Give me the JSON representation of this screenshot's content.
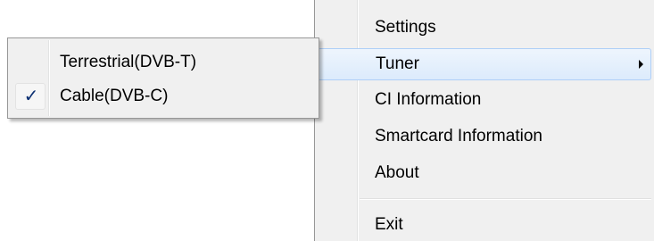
{
  "main_menu": {
    "items": [
      {
        "label": "Settings"
      },
      {
        "label": "Tuner",
        "has_submenu": true,
        "highlighted": true
      },
      {
        "label": "CI Information"
      },
      {
        "label": "Smartcard Information"
      },
      {
        "label": "About"
      },
      {
        "label": "Exit"
      }
    ],
    "arrow_icon": "submenu-arrow-icon"
  },
  "tuner_submenu": {
    "items": [
      {
        "label": "Terrestrial(DVB-T)",
        "checked": false
      },
      {
        "label": "Cable(DVB-C)",
        "checked": true
      }
    ],
    "check_icon": "checkmark-icon",
    "check_glyph": "✓"
  },
  "colors": {
    "menu_bg": "#f0f0f0",
    "highlight_border": "#aecff7",
    "check_color": "#0b2f72"
  }
}
